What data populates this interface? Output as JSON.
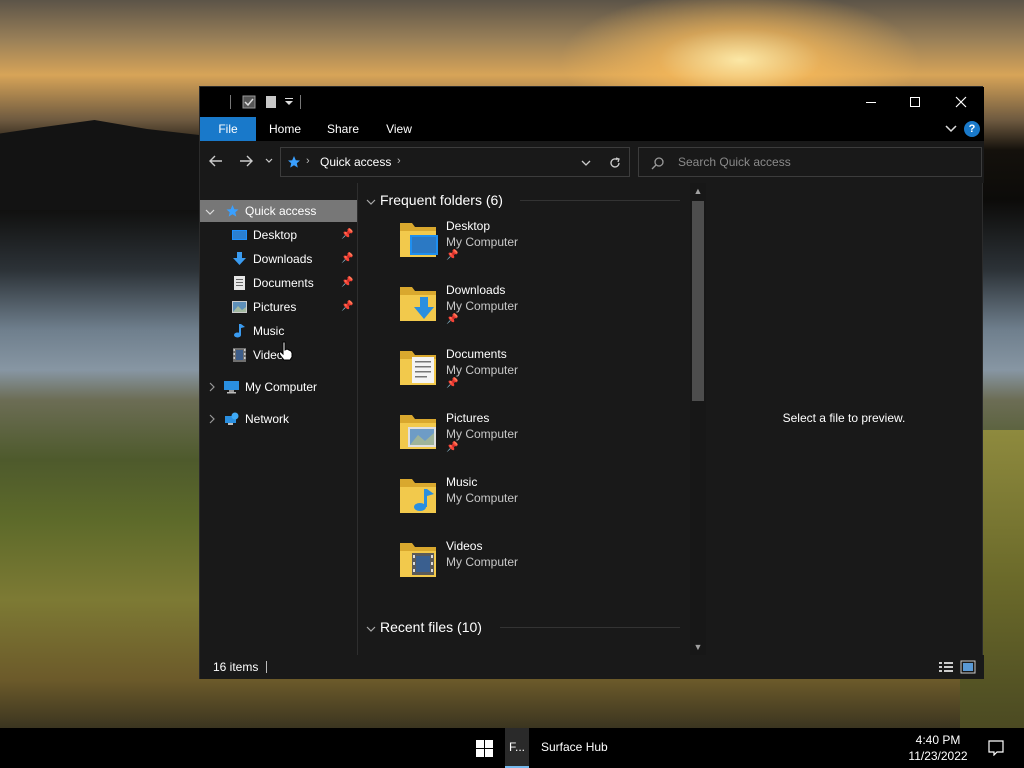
{
  "colors": {
    "accent": "#1979ca",
    "window_bg": "#191919",
    "titlebar_bg": "#000000",
    "selected_nav": "#777777",
    "folder_yellow": "#f2c94c",
    "taskbar_bg": "#000000"
  },
  "window": {
    "controls": {
      "minimize_icon": "minimize-icon",
      "maximize_icon": "maximize-icon",
      "close_icon": "close-icon"
    }
  },
  "ribbon": {
    "tabs": [
      {
        "label": "File"
      },
      {
        "label": "Home"
      },
      {
        "label": "Share"
      },
      {
        "label": "View"
      }
    ]
  },
  "address": {
    "path": [
      "Quick access"
    ],
    "search_placeholder": "Search Quick access"
  },
  "nav_pane": {
    "quick_access": "Quick access",
    "items": [
      {
        "label": "Desktop",
        "icon": "desktop-icon",
        "pinned": true
      },
      {
        "label": "Downloads",
        "icon": "downloads-icon",
        "pinned": true
      },
      {
        "label": "Documents",
        "icon": "documents-icon",
        "pinned": true
      },
      {
        "label": "Pictures",
        "icon": "pictures-icon",
        "pinned": true
      },
      {
        "label": "Music",
        "icon": "music-icon",
        "pinned": false
      },
      {
        "label": "Videos",
        "icon": "videos-icon",
        "pinned": false
      }
    ],
    "my_computer": "My Computer",
    "network": "Network"
  },
  "content": {
    "frequent_header": "Frequent folders (6)",
    "recent_header": "Recent files (10)",
    "folders": [
      {
        "name": "Desktop",
        "location": "My Computer",
        "pinned": true
      },
      {
        "name": "Downloads",
        "location": "My Computer",
        "pinned": true
      },
      {
        "name": "Documents",
        "location": "My Computer",
        "pinned": true
      },
      {
        "name": "Pictures",
        "location": "My Computer",
        "pinned": true
      },
      {
        "name": "Music",
        "location": "My Computer",
        "pinned": false
      },
      {
        "name": "Videos",
        "location": "My Computer",
        "pinned": false
      }
    ]
  },
  "preview": {
    "message": "Select a file to preview."
  },
  "status": {
    "item_count": "16 items"
  },
  "taskbar": {
    "explorer_label": "F...",
    "app_label": "Surface Hub",
    "time": "4:40 PM",
    "date": "11/23/2022"
  }
}
